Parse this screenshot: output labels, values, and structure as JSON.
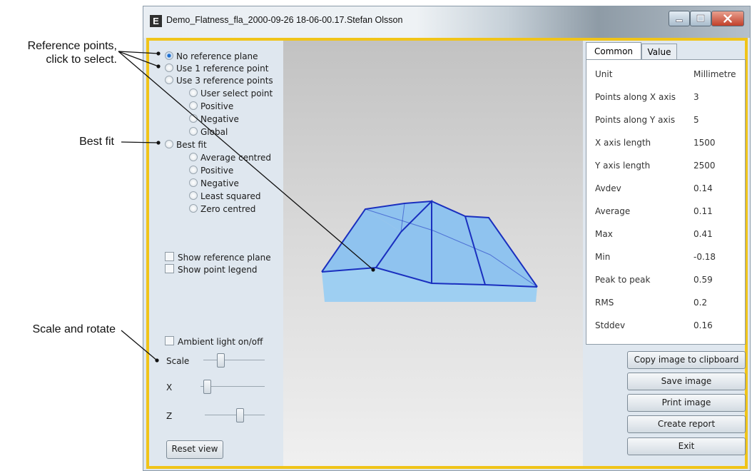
{
  "callouts": {
    "reference_line1": "Reference points,",
    "reference_line2": "click to select.",
    "best_fit": "Best fit",
    "scale_rotate": "Scale and rotate"
  },
  "window": {
    "title": "Demo_Flatness_fla_2000-09-26 18-06-00.17.Stefan Olsson",
    "app_icon_letter": "E"
  },
  "reference": {
    "options": [
      {
        "label": "No reference plane",
        "selected": true
      },
      {
        "label": "Use 1 reference point",
        "selected": false
      },
      {
        "label": "Use 3 reference points",
        "selected": false
      }
    ],
    "sub_options": [
      {
        "label": "User select point"
      },
      {
        "label": "Positive"
      },
      {
        "label": "Negative"
      },
      {
        "label": "Global"
      }
    ]
  },
  "best_fit": {
    "label": "Best fit",
    "sub_options": [
      {
        "label": "Average centred"
      },
      {
        "label": "Positive"
      },
      {
        "label": "Negative"
      },
      {
        "label": "Least squared"
      },
      {
        "label": "Zero centred"
      }
    ]
  },
  "display": {
    "show_reference_plane": "Show reference plane",
    "show_point_legend": "Show point legend",
    "ambient_light": "Ambient light on/off"
  },
  "controls": {
    "scale_label": "Scale",
    "scale_level": 0.25,
    "x_label": "X",
    "x_level": 0.05,
    "z_label": "Z",
    "z_level": 0.6,
    "reset_label": "Reset view"
  },
  "tabs": {
    "common": "Common",
    "value": "Value"
  },
  "properties": [
    {
      "key": "Unit",
      "value": "Millimetre"
    },
    {
      "key": "Points along X axis",
      "value": "3"
    },
    {
      "key": "Points along Y axis",
      "value": "5"
    },
    {
      "key": "X axis length",
      "value": "1500"
    },
    {
      "key": "Y axis length",
      "value": "2500"
    },
    {
      "key": "Avdev",
      "value": "0.14"
    },
    {
      "key": "Average",
      "value": "0.11"
    },
    {
      "key": "Max",
      "value": "0.41"
    },
    {
      "key": "Min",
      "value": "-0.18"
    },
    {
      "key": "Peak to peak",
      "value": "0.59"
    },
    {
      "key": "RMS",
      "value": "0.2"
    },
    {
      "key": "Stddev",
      "value": "0.16"
    }
  ],
  "actions": {
    "copy": "Copy image to clipboard",
    "save": "Save image",
    "print": "Print image",
    "report": "Create report",
    "exit": "Exit"
  },
  "colors": {
    "frame_highlight": "#f0c419",
    "surface_fill": "#8fc3ef",
    "surface_edge": "#1a2fbf"
  }
}
